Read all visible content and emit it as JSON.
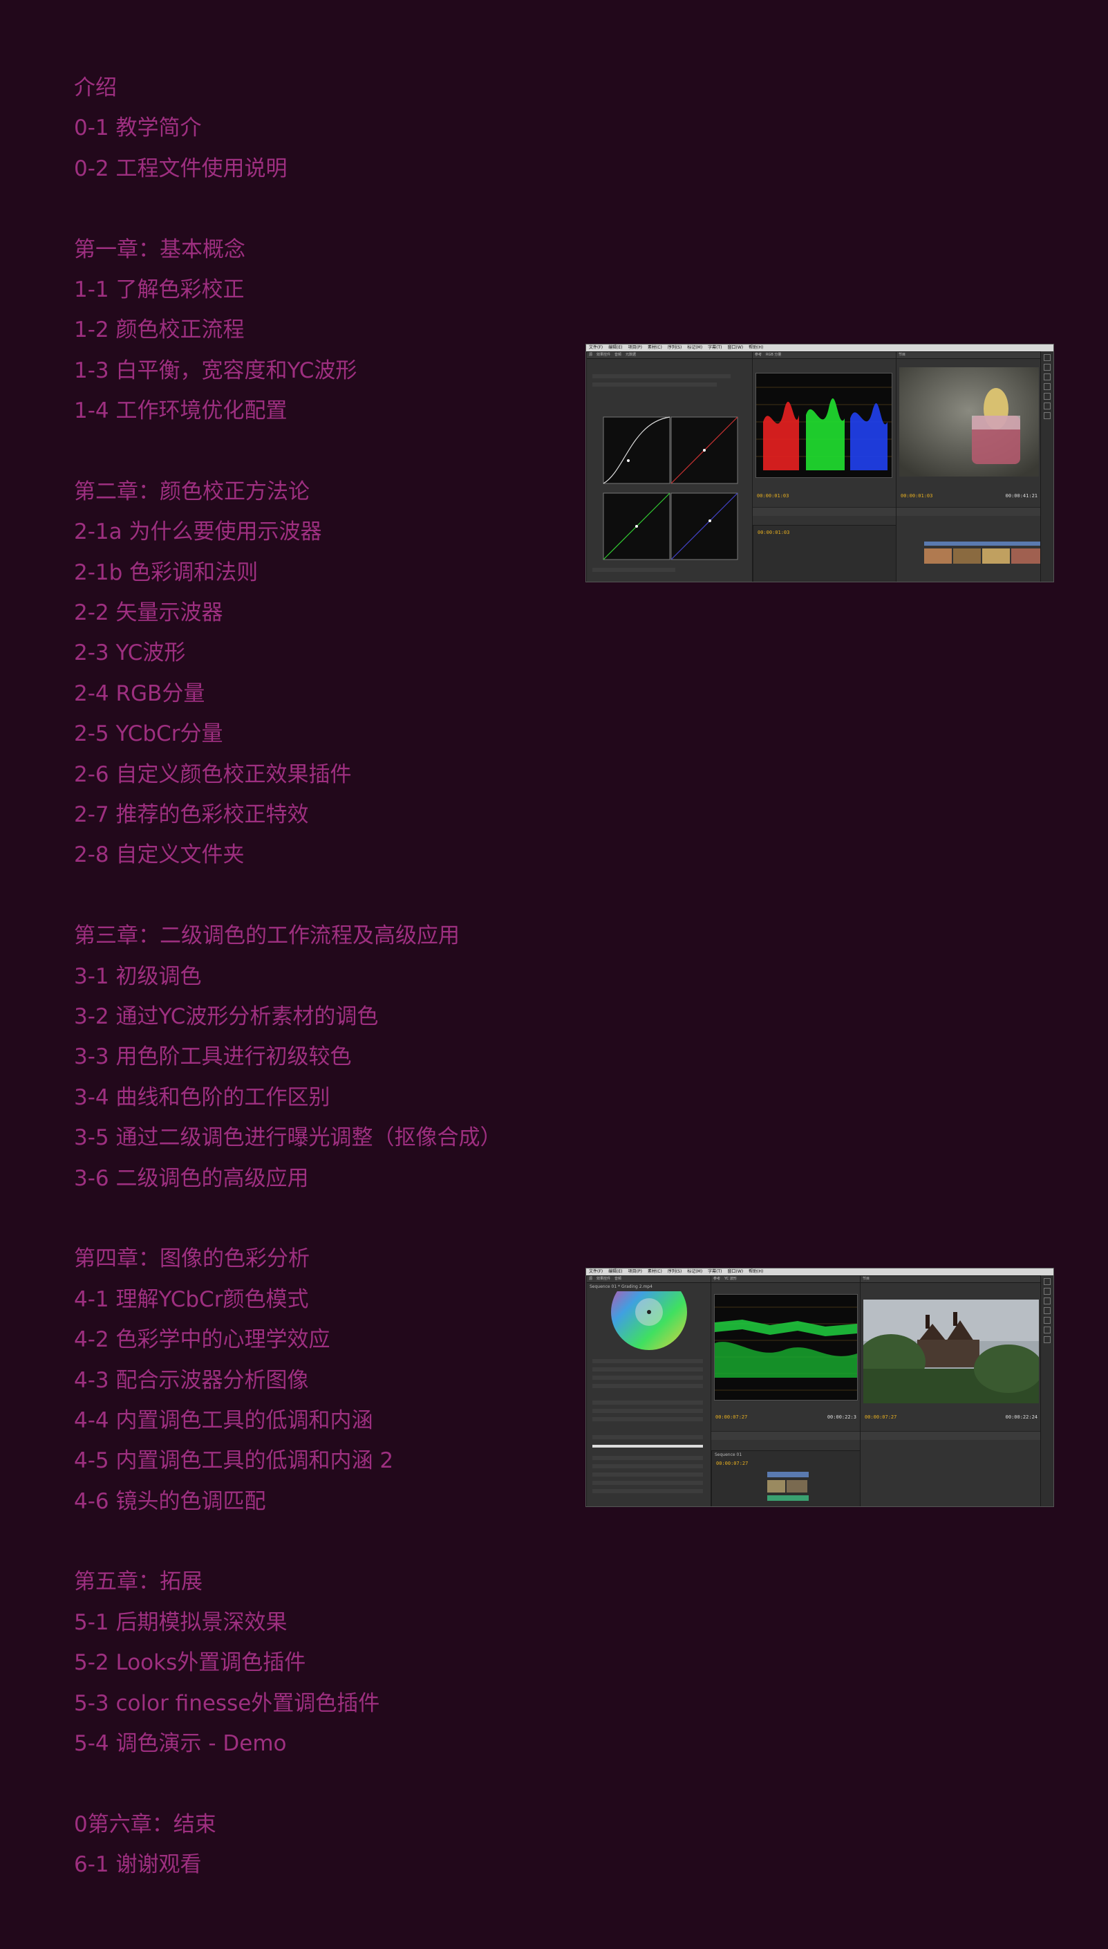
{
  "toc": [
    {
      "label": "介绍"
    },
    {
      "label": "0-1 教学简介"
    },
    {
      "label": "0-2 工程文件使用说明"
    },
    {
      "label": ""
    },
    {
      "label": "第一章：基本概念"
    },
    {
      "label": "1-1 了解色彩校正"
    },
    {
      "label": "1-2 颜色校正流程"
    },
    {
      "label": "1-3 白平衡，宽容度和YC波形"
    },
    {
      "label": "1-4 工作环境优化配置"
    },
    {
      "label": ""
    },
    {
      "label": "第二章：颜色校正方法论"
    },
    {
      "label": "2-1a 为什么要使用示波器"
    },
    {
      "label": "2-1b 色彩调和法则"
    },
    {
      "label": "2-2 矢量示波器"
    },
    {
      "label": "2-3 YC波形"
    },
    {
      "label": "2-4 RGB分量"
    },
    {
      "label": "2-5 YCbCr分量"
    },
    {
      "label": "2-6 自定义颜色校正效果插件"
    },
    {
      "label": "2-7 推荐的色彩校正特效"
    },
    {
      "label": "2-8 自定义文件夹"
    },
    {
      "label": ""
    },
    {
      "label": "第三章：二级调色的工作流程及高级应用"
    },
    {
      "label": "3-1 初级调色"
    },
    {
      "label": "3-2 通过YC波形分析素材的调色"
    },
    {
      "label": "3-3 用色阶工具进行初级较色"
    },
    {
      "label": "3-4 曲线和色阶的工作区别"
    },
    {
      "label": "3-5 通过二级调色进行曝光调整（抠像合成）"
    },
    {
      "label": "3-6 二级调色的高级应用"
    },
    {
      "label": ""
    },
    {
      "label": "第四章：图像的色彩分析"
    },
    {
      "label": "4-1 理解YCbCr颜色模式"
    },
    {
      "label": "4-2 色彩学中的心理学效应"
    },
    {
      "label": "4-3 配合示波器分析图像"
    },
    {
      "label": "4-4 内置调色工具的低调和内涵"
    },
    {
      "label": "4-5 内置调色工具的低调和内涵 2"
    },
    {
      "label": "4-6 镜头的色调匹配"
    },
    {
      "label": ""
    },
    {
      "label": "第五章：拓展"
    },
    {
      "label": "5-1 后期模拟景深效果"
    },
    {
      "label": "5-2 Looks外置调色插件"
    },
    {
      "label": "5-3 color finesse外置调色插件"
    },
    {
      "label": "5-4 调色演示 - Demo"
    },
    {
      "label": ""
    },
    {
      "label": "0第六章：结束"
    },
    {
      "label": "6-1 谢谢观看"
    }
  ],
  "shot1": {
    "menu": [
      "文件(F)",
      "编辑(E)",
      "项目(P)",
      "素材(C)",
      "序列(S)",
      "标记(M)",
      "字幕(T)",
      "窗口(W)",
      "帮助(H)"
    ],
    "source_tc": "00:00:01:03",
    "program_tc": "00:00:01:03",
    "program_end": "00:00:41:21",
    "timeline_tc": "00:00:01:03"
  },
  "shot2": {
    "menu": [
      "文件(F)",
      "编辑(E)",
      "项目(P)",
      "素材(C)",
      "序列(S)",
      "标记(M)",
      "字幕(T)",
      "窗口(W)",
      "帮助(H)"
    ],
    "panel_title": "Sequence 01 * Grading 2.mp4",
    "source_tc": "00:00:07:27",
    "source_end": "00:00:22:3",
    "program_tc": "00:00:07:27",
    "program_end": "00:00:22:24",
    "timeline_tc": "00:00:07:27",
    "timeline_title": "Sequence 01"
  },
  "colors": {
    "background": "#22081b",
    "text": "#9e2f80",
    "timecode": "#e8b020"
  }
}
